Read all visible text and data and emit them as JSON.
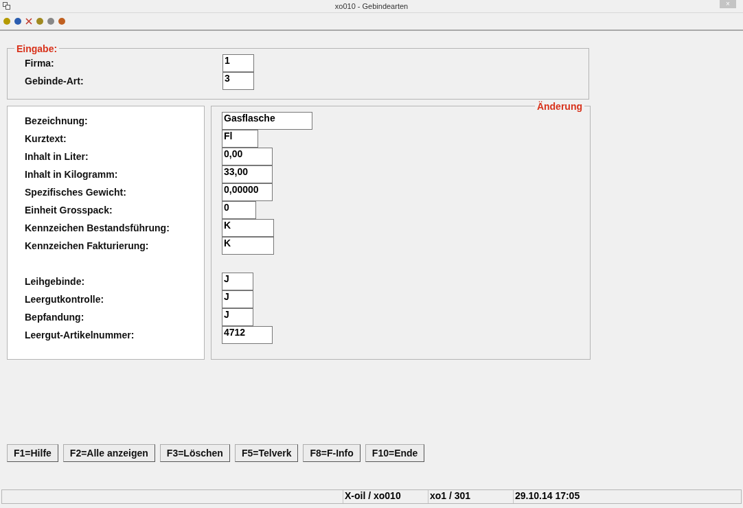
{
  "window": {
    "title": "xo010 - Gebindearten",
    "close": "×"
  },
  "input_section": {
    "legend": "Eingabe:",
    "fields": [
      {
        "label": "Firma:",
        "value": "1"
      },
      {
        "label": "Gebinde-Art:",
        "value": "3"
      }
    ]
  },
  "change_section": {
    "legend": "Änderung",
    "groups": [
      [
        {
          "label": "Bezeichnung:",
          "value": "Gasflasche"
        },
        {
          "label": "Kurztext:",
          "value": "Fl"
        },
        {
          "label": "Inhalt in Liter:",
          "value": "0,00"
        },
        {
          "label": "Inhalt in Kilogramm:",
          "value": "33,00"
        },
        {
          "label": "Spezifisches Gewicht:",
          "value": "0,00000"
        },
        {
          "label": "Einheit Grosspack:",
          "value": "0"
        },
        {
          "label": "Kennzeichen Bestandsführung:",
          "value": "K"
        },
        {
          "label": "Kennzeichen Fakturierung:",
          "value": "K"
        }
      ],
      [
        {
          "label": "Leihgebinde:",
          "value": "J"
        },
        {
          "label": "Leergutkontrolle:",
          "value": "J"
        },
        {
          "label": "Bepfandung:",
          "value": "J"
        },
        {
          "label": "Leergut-Artikelnummer:",
          "value": "4712"
        }
      ]
    ]
  },
  "buttons": [
    "F1=Hilfe",
    "F2=Alle anzeigen",
    "F3=Löschen",
    "F5=Telverk",
    "F8=F-Info",
    "F10=Ende"
  ],
  "status_bar": [
    "X-oil / xo010",
    "xo1 / 301",
    "29.10.14 17:05"
  ]
}
